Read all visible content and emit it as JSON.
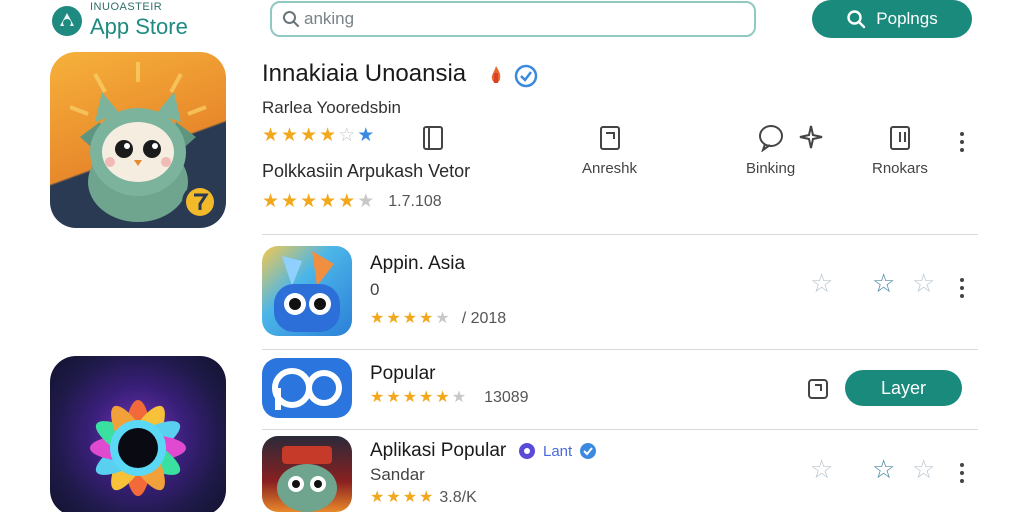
{
  "header": {
    "logo_sub": "INUOASTEIR",
    "logo_title": "App Store",
    "search_placeholder": "anking",
    "popular_button": "Poplngs",
    "icons": {
      "logo": "app-store-logo-icon",
      "search": "search-icon",
      "button": "search-icon"
    }
  },
  "featured": {
    "title": "Innakiaia Unoansia",
    "developer": "Rarlea Yooredsbin",
    "category": "Polkkasiin Arpukash Vetor",
    "rating_count": "1.7.108",
    "stars_top": 3.5,
    "stars_bottom": 5,
    "actions": [
      {
        "label": "",
        "icon": "bookmark-icon"
      },
      {
        "label": "Anreshk",
        "icon": "share-icon"
      },
      {
        "label": "Binking",
        "icon": "chat-bubble-icon"
      },
      {
        "label": "",
        "icon": "sparkle-icon"
      },
      {
        "label": "Rnokars",
        "icon": "report-icon"
      }
    ]
  },
  "list": [
    {
      "name": "Appin. Asia",
      "sub": "0",
      "stars": 3.5,
      "count": "/ 2018"
    },
    {
      "name": "Popular",
      "sub": "",
      "stars": 4.5,
      "count": "13089",
      "button": "Layer"
    },
    {
      "name": "Aplikasi Popular",
      "badge": "Lant",
      "sub": "Sandar",
      "stars": 4,
      "count": "3.8/K"
    }
  ],
  "colors": {
    "accent": "#1a8a7c",
    "star": "#f2a81c",
    "verified": "#3b8ae0"
  }
}
